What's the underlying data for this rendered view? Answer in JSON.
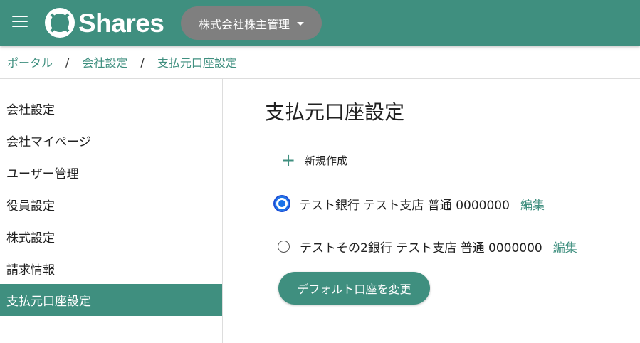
{
  "header": {
    "logo_text": "Shares",
    "company_selector": "株式会社株主管理",
    "icons": {
      "menu": "menu-icon",
      "logo": "lifebuoy-logo-icon",
      "dropdown": "caret-down-icon"
    },
    "colors": {
      "primary": "#3f8f7f",
      "selector_bg": "#7f7f7f"
    }
  },
  "breadcrumb": {
    "items": [
      "ポータル",
      "会社設定",
      "支払元口座設定"
    ],
    "separator": "/"
  },
  "sidebar": {
    "items": [
      {
        "label": "会社設定",
        "active": false
      },
      {
        "label": "会社マイページ",
        "active": false
      },
      {
        "label": "ユーザー管理",
        "active": false
      },
      {
        "label": "役員設定",
        "active": false
      },
      {
        "label": "株式設定",
        "active": false
      },
      {
        "label": "請求情報",
        "active": false
      },
      {
        "label": "支払元口座設定",
        "active": true
      }
    ]
  },
  "main": {
    "title": "支払元口座設定",
    "new_button": {
      "icon": "plus-icon",
      "label": "新規作成"
    },
    "accounts": [
      {
        "text": "テスト銀行 テスト支店 普通 0000000",
        "selected": true,
        "edit_label": "編集"
      },
      {
        "text": "テストその2銀行 テスト支店 普通 0000000",
        "selected": false,
        "edit_label": "編集"
      }
    ],
    "default_button_label": "デフォルト口座を変更"
  }
}
